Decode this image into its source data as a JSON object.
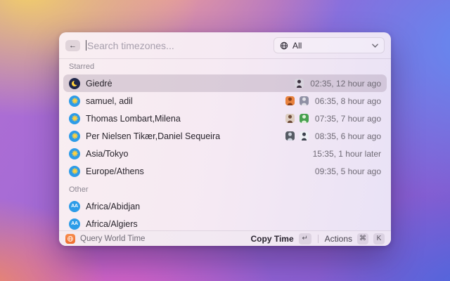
{
  "window": {
    "search": {
      "placeholder": "Search timezones..."
    },
    "filter": {
      "label": "All"
    },
    "icons": {
      "back_arrow": "←"
    }
  },
  "sections": [
    {
      "label": "Starred",
      "items": [
        {
          "label": "Giedrė",
          "icon": {
            "type": "moon"
          },
          "selected": true,
          "avatars": [
            {
              "bg": "#d8d4de",
              "fg": "#3c3240"
            }
          ],
          "time": "02:35, 12 hour ago"
        },
        {
          "label": "samuel, adil",
          "icon": {
            "type": "sun"
          },
          "selected": false,
          "avatars": [
            {
              "bg": "#e8813d",
              "fg": "#8a4018"
            },
            {
              "bg": "#8f90a4",
              "fg": "#e0e0e6"
            }
          ],
          "time": "06:35, 8 hour ago"
        },
        {
          "label": "Thomas Lombart,Milena",
          "icon": {
            "type": "sun"
          },
          "selected": false,
          "avatars": [
            {
              "bg": "#ddcdc1",
              "fg": "#6e4b38"
            },
            {
              "bg": "#47a04f",
              "fg": "#dff0d8"
            }
          ],
          "time": "07:35, 7 hour ago"
        },
        {
          "label": "Per Nielsen Tikær,Daniel Sequeira",
          "icon": {
            "type": "sun"
          },
          "selected": false,
          "avatars": [
            {
              "bg": "#565b64",
              "fg": "#cdd3dd"
            },
            {
              "bg": "#eef0f4",
              "fg": "#3c414c"
            }
          ],
          "time": "08:35, 6 hour ago"
        },
        {
          "label": "Asia/Tokyo",
          "icon": {
            "type": "sun"
          },
          "selected": false,
          "avatars": [],
          "time": "15:35, 1 hour later"
        },
        {
          "label": "Europe/Athens",
          "icon": {
            "type": "sun"
          },
          "selected": false,
          "avatars": [],
          "time": "09:35, 5 hour ago"
        }
      ]
    },
    {
      "label": "Other",
      "items": [
        {
          "label": "Africa/Abidjan",
          "icon": {
            "type": "initials",
            "initials": "AA"
          },
          "selected": false,
          "avatars": [],
          "time": ""
        },
        {
          "label": "Africa/Algiers",
          "icon": {
            "type": "initials",
            "initials": "AA"
          },
          "selected": false,
          "avatars": [],
          "time": ""
        }
      ]
    }
  ],
  "footer": {
    "app_name": "Query World Time",
    "primary_action": "Copy Time",
    "primary_key": "↵",
    "actions_label": "Actions",
    "action_keys": [
      "⌘",
      "K"
    ]
  },
  "colors": {
    "accent_blue_icon": "#2d9ce8",
    "moon_navy": "#20284a",
    "sun_yellow": "#ffd23e",
    "app_icon_orange": "#ee6c2c",
    "selected_row": "rgba(128,108,134,0.24)"
  }
}
